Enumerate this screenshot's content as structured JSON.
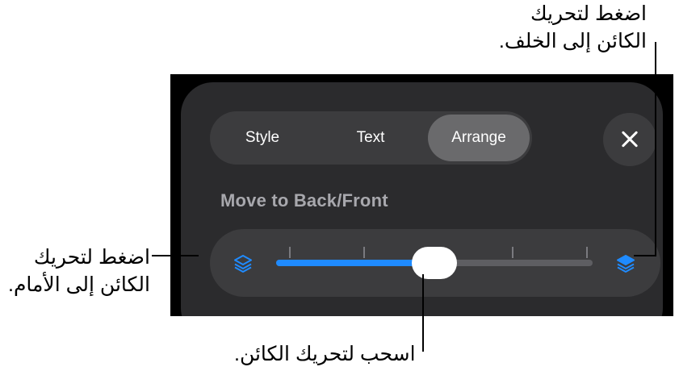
{
  "callouts": {
    "move_back": {
      "line1": "اضغط لتحريك",
      "line2": "الكائن إلى الخلف."
    },
    "move_front": {
      "line1": "اضغط لتحريك",
      "line2": "الكائن إلى الأمام."
    },
    "drag": {
      "line1": "اسحب لتحريك الكائن."
    }
  },
  "tabs": [
    {
      "label": "Style",
      "active": false
    },
    {
      "label": "Text",
      "active": false
    },
    {
      "label": "Arrange",
      "active": true
    }
  ],
  "section_label": "Move to Back/Front",
  "slider": {
    "value_fraction": 0.5,
    "tick_count": 5
  },
  "colors": {
    "accent": "#1f8bff",
    "sheet": "#2b2b2d",
    "control": "#3c3c3e",
    "active_tab": "#6a6a6c"
  },
  "icons": {
    "close": "close-icon",
    "back": "layers-back-icon",
    "front": "layers-front-icon"
  }
}
